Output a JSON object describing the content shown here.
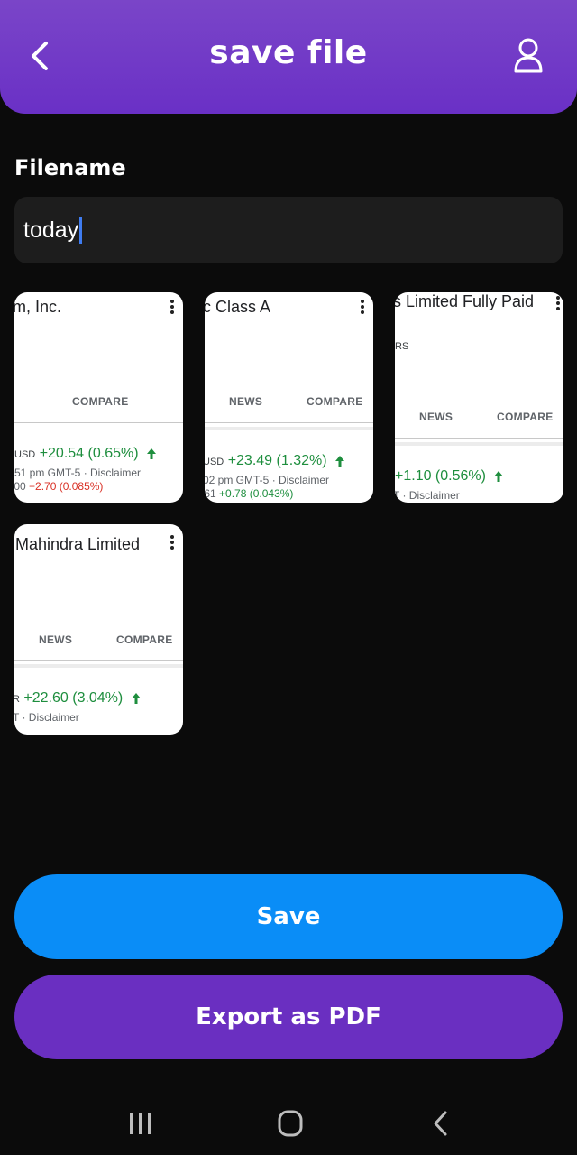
{
  "header": {
    "title": "save file",
    "back_icon": "chevron-left-icon",
    "user_icon": "user-icon"
  },
  "form": {
    "label": "Filename",
    "value": "today"
  },
  "cards": [
    {
      "name": "m, Inc.",
      "tabs": [
        "COMPARE"
      ],
      "price_currency": "USD",
      "price_change": "+20.54 (0.65%)",
      "meta": "51 pm GMT-5 · Disclaimer",
      "after_value": ".00",
      "after_change": "−2.70 (0.085%)"
    },
    {
      "name": "c Class A",
      "tabs": [
        "NEWS",
        "COMPARE"
      ],
      "price_currency": "USD",
      "price_change": "+23.49 (1.32%)",
      "meta": "02 pm GMT-5 · Disclaimer",
      "after_value": ".61",
      "after_change": "+0.78 (0.043%)"
    },
    {
      "name": "s Limited Fully Paid",
      "sub": "RS",
      "tabs": [
        "NEWS",
        "COMPARE"
      ],
      "price_change": "+1.10 (0.56%)",
      "meta": "T · Disclaimer"
    },
    {
      "name": "Mahindra Limited",
      "tabs": [
        "NEWS",
        "COMPARE"
      ],
      "price_currency": "R",
      "price_change": "+22.60 (3.04%)",
      "meta": "T · Disclaimer"
    }
  ],
  "buttons": {
    "save": "Save",
    "export": "Export as PDF"
  },
  "navbar": {
    "recents_icon": "recents-icon",
    "home_icon": "home-icon",
    "back_icon": "back-icon"
  },
  "colors": {
    "header": "#7040c8",
    "save": "#0a8df7",
    "export": "#6a2fc1",
    "positive": "#1e8e3e",
    "negative": "#d93025"
  }
}
